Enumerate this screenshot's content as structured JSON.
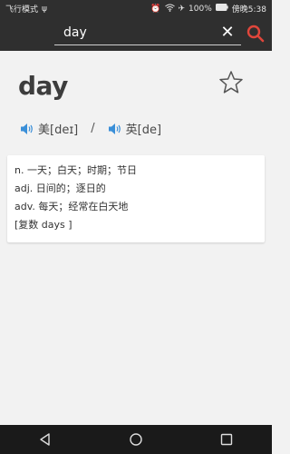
{
  "status_bar": {
    "mode_text": "飞行模式 ",
    "battery_text": "100%",
    "carrier_text": "傍晚5:38"
  },
  "search": {
    "value": "day"
  },
  "word": {
    "headword": "day",
    "phonetics": [
      {
        "label": "美[deɪ]"
      },
      {
        "label": "英[de]"
      }
    ],
    "separator": "/",
    "definitions": [
      "n. 一天；白天；时期；节日",
      "adj. 日间的；逐日的",
      "adv. 每天；经常在白天地",
      "[复数 days ]"
    ]
  },
  "colors": {
    "header_bg": "#2f2f2f",
    "accent_red": "#e0463b",
    "page_bg": "#f2f2f2"
  },
  "icons": {
    "clear": "close-icon",
    "search": "search-icon",
    "favorite": "star-icon",
    "speaker": "speaker-icon"
  }
}
